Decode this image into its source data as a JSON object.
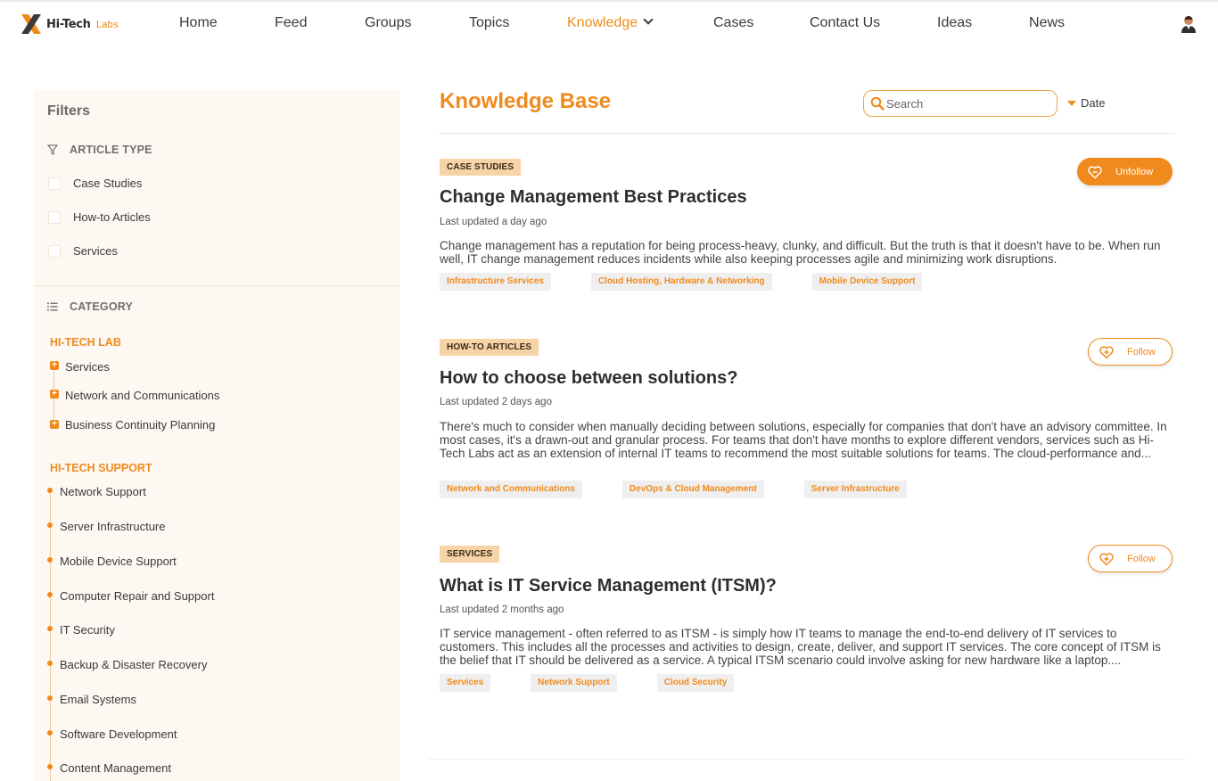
{
  "brand": {
    "name": "Hi-Tech",
    "suffix": "Labs",
    "accent": "#f08a1c"
  },
  "nav": {
    "items": [
      "Home",
      "Feed",
      "Groups",
      "Topics",
      "Knowledge",
      "Cases",
      "Contact Us",
      "Ideas",
      "News"
    ],
    "active": "Knowledge",
    "avatar_icon": "user-avatar"
  },
  "filters": {
    "title": "Filters",
    "article_type": {
      "heading": "ARTICLE TYPE",
      "icon": "filter-icon",
      "options": [
        "Case Studies",
        "How-to Articles",
        "Services"
      ]
    },
    "category": {
      "heading": "CATEGORY",
      "icon": "list-icon",
      "groups": [
        {
          "name": "HI-TECH LAB",
          "items": [
            "Services",
            "Network and Communications",
            "Business Continuity Planning"
          ]
        },
        {
          "name": "HI-TECH SUPPORT",
          "items": [
            "Network Support",
            "Server Infrastructure",
            "Mobile Device Support",
            "Computer Repair and Support",
            "IT Security",
            "Backup & Disaster Recovery",
            "Email Systems",
            "Software Development",
            "Content Management"
          ]
        }
      ]
    }
  },
  "main": {
    "title": "Knowledge Base",
    "search_placeholder": "Search",
    "sort_label": "Date",
    "articles": [
      {
        "type": "CASE STUDIES",
        "title": "Change Management Best Practices",
        "updated": "Last updated a day ago",
        "excerpt": "Change management has a reputation for being process-heavy, clunky, and difficult. But the truth is that it doesn't have to be. When run well, IT change management reduces incidents while also keeping processes agile and minimizing work disruptions.",
        "tags": [
          "Infrastructure Services",
          "Cloud Hosting, Hardware & Networking",
          "Mobile Device Support"
        ],
        "follow_label": "Unfollow",
        "following": true
      },
      {
        "type": "HOW-TO ARTICLES",
        "title": "How to choose between solutions?",
        "updated": "Last updated 2 days ago",
        "excerpt": "There's much to consider when manually deciding between solutions, especially for companies that don't have an advisory committee. In most cases, it's a drawn-out and granular process. For teams that don't have months to explore different vendors, services such as Hi-Tech Labs act as an extension of internal IT teams to recommend the most suitable solutions for teams. The cloud-performance and...",
        "tags": [
          "Network and Communications",
          "DevOps & Cloud Management",
          "Server Infrastructure"
        ],
        "follow_label": "Follow",
        "following": false
      },
      {
        "type": "SERVICES",
        "title": "What is IT Service Management (ITSM)?",
        "updated": "Last updated 2 months ago",
        "excerpt": "IT service management - often referred to as ITSM - is simply how IT teams to manage the end-to-end delivery of IT services to customers. This includes all the processes and activities to design, create, deliver, and support IT services. The core concept of ITSM is the belief that IT should be delivered as a service. A typical ITSM scenario could involve asking for new hardware like a laptop....",
        "tags": [
          "Services",
          "Network Support",
          "Cloud Security"
        ],
        "follow_label": "Follow",
        "following": false
      }
    ]
  }
}
